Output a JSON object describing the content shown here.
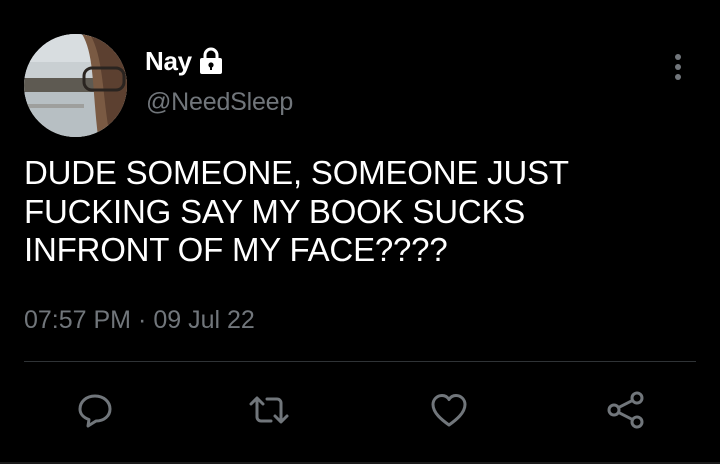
{
  "tweet": {
    "display_name": "Nay",
    "handle": "@NeedSleep",
    "text": "DUDE SOMEONE, SOMEONE JUST\nFUCKING SAY MY BOOK SUCKS\nINFRONT OF MY FACE????",
    "time": "07:57 PM",
    "separator": "·",
    "date": "09 Jul 22",
    "protected_icon": "lock-icon",
    "menu_icon": "more-vertical-icon"
  },
  "actions": [
    {
      "name": "reply",
      "icon": "comment-icon"
    },
    {
      "name": "retweet",
      "icon": "retweet-icon"
    },
    {
      "name": "like",
      "icon": "heart-icon"
    },
    {
      "name": "share",
      "icon": "share-icon"
    }
  ],
  "colors": {
    "background": "#000000",
    "text": "#ffffff",
    "secondary_text": "#71767b",
    "divider": "#2f3336"
  }
}
